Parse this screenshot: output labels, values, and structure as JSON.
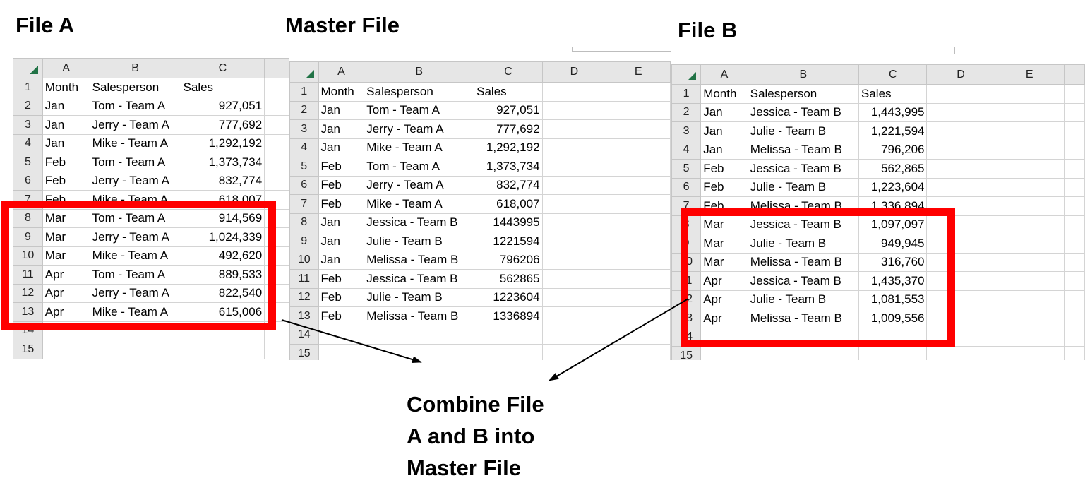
{
  "headings": {
    "file_a": "File A",
    "master": "Master File",
    "file_b": "File B"
  },
  "note": {
    "line1": "Combine File",
    "line2": "A and B into",
    "line3": "Master File"
  },
  "colors": {
    "highlight": "#ff0000",
    "header_bg": "#e6e6e6",
    "select_all": "#217346"
  },
  "icons": {
    "select_all": "select-all-triangle-icon"
  },
  "sheets": {
    "file_a": {
      "columns": [
        "A",
        "B",
        "C"
      ],
      "rows": [
        {
          "n": "1",
          "a": "Month",
          "b": "Salesperson",
          "c": "Sales",
          "d": "",
          "e": ""
        },
        {
          "n": "2",
          "a": "Jan",
          "b": "Tom - Team A",
          "c": "927,051",
          "d": "",
          "e": ""
        },
        {
          "n": "3",
          "a": "Jan",
          "b": "Jerry - Team A",
          "c": "777,692",
          "d": "",
          "e": ""
        },
        {
          "n": "4",
          "a": "Jan",
          "b": "Mike - Team A",
          "c": "1,292,192",
          "d": "",
          "e": ""
        },
        {
          "n": "5",
          "a": "Feb",
          "b": "Tom - Team A",
          "c": "1,373,734",
          "d": "",
          "e": ""
        },
        {
          "n": "6",
          "a": "Feb",
          "b": "Jerry - Team A",
          "c": "832,774",
          "d": "",
          "e": ""
        },
        {
          "n": "7",
          "a": "Feb",
          "b": "Mike - Team A",
          "c": "618,007",
          "d": "",
          "e": ""
        },
        {
          "n": "8",
          "a": "Mar",
          "b": "Tom - Team A",
          "c": "914,569",
          "d": "",
          "e": ""
        },
        {
          "n": "9",
          "a": "Mar",
          "b": "Jerry - Team A",
          "c": "1,024,339",
          "d": "",
          "e": ""
        },
        {
          "n": "10",
          "a": "Mar",
          "b": "Mike - Team A",
          "c": "492,620",
          "d": "",
          "e": ""
        },
        {
          "n": "11",
          "a": "Apr",
          "b": "Tom - Team A",
          "c": "889,533",
          "d": "",
          "e": ""
        },
        {
          "n": "12",
          "a": "Apr",
          "b": "Jerry - Team A",
          "c": "822,540",
          "d": "",
          "e": ""
        },
        {
          "n": "13",
          "a": "Apr",
          "b": "Mike - Team A",
          "c": "615,006",
          "d": "",
          "e": ""
        },
        {
          "n": "14",
          "a": "",
          "b": "",
          "c": "",
          "d": "",
          "e": ""
        },
        {
          "n": "15",
          "a": "",
          "b": "",
          "c": "",
          "d": "",
          "e": ""
        }
      ]
    },
    "master": {
      "columns": [
        "A",
        "B",
        "C",
        "D",
        "E"
      ],
      "rows": [
        {
          "n": "1",
          "a": "Month",
          "b": "Salesperson",
          "c": "Sales",
          "d": "",
          "e": ""
        },
        {
          "n": "2",
          "a": "Jan",
          "b": "Tom - Team A",
          "c": "927,051",
          "d": "",
          "e": ""
        },
        {
          "n": "3",
          "a": "Jan",
          "b": "Jerry - Team A",
          "c": "777,692",
          "d": "",
          "e": ""
        },
        {
          "n": "4",
          "a": "Jan",
          "b": "Mike - Team A",
          "c": "1,292,192",
          "d": "",
          "e": ""
        },
        {
          "n": "5",
          "a": "Feb",
          "b": "Tom - Team A",
          "c": "1,373,734",
          "d": "",
          "e": ""
        },
        {
          "n": "6",
          "a": "Feb",
          "b": "Jerry - Team A",
          "c": "832,774",
          "d": "",
          "e": ""
        },
        {
          "n": "7",
          "a": "Feb",
          "b": "Mike - Team A",
          "c": "618,007",
          "d": "",
          "e": ""
        },
        {
          "n": "8",
          "a": "Jan",
          "b": "Jessica  - Team B",
          "c": "1443995",
          "d": "",
          "e": ""
        },
        {
          "n": "9",
          "a": "Jan",
          "b": "Julie - Team B",
          "c": "1221594",
          "d": "",
          "e": ""
        },
        {
          "n": "10",
          "a": "Jan",
          "b": "Melissa - Team B",
          "c": "796206",
          "d": "",
          "e": ""
        },
        {
          "n": "11",
          "a": "Feb",
          "b": "Jessica  - Team B",
          "c": "562865",
          "d": "",
          "e": ""
        },
        {
          "n": "12",
          "a": "Feb",
          "b": "Julie - Team B",
          "c": "1223604",
          "d": "",
          "e": ""
        },
        {
          "n": "13",
          "a": "Feb",
          "b": "Melissa - Team B",
          "c": "1336894",
          "d": "",
          "e": ""
        },
        {
          "n": "14",
          "a": "",
          "b": "",
          "c": "",
          "d": "",
          "e": ""
        },
        {
          "n": "15",
          "a": "",
          "b": "",
          "c": "",
          "d": "",
          "e": ""
        }
      ]
    },
    "file_b": {
      "columns": [
        "A",
        "B",
        "C",
        "D",
        "E"
      ],
      "rows": [
        {
          "n": "1",
          "a": "Month",
          "b": "Salesperson",
          "c": "Sales",
          "d": "",
          "e": ""
        },
        {
          "n": "2",
          "a": "Jan",
          "b": "Jessica  - Team B",
          "c": "1,443,995",
          "d": "",
          "e": ""
        },
        {
          "n": "3",
          "a": "Jan",
          "b": "Julie - Team B",
          "c": "1,221,594",
          "d": "",
          "e": ""
        },
        {
          "n": "4",
          "a": "Jan",
          "b": "Melissa - Team B",
          "c": "796,206",
          "d": "",
          "e": ""
        },
        {
          "n": "5",
          "a": "Feb",
          "b": "Jessica  - Team B",
          "c": "562,865",
          "d": "",
          "e": ""
        },
        {
          "n": "6",
          "a": "Feb",
          "b": "Julie - Team B",
          "c": "1,223,604",
          "d": "",
          "e": ""
        },
        {
          "n": "7",
          "a": "Feb",
          "b": "Melissa - Team B",
          "c": "1,336,894",
          "d": "",
          "e": ""
        },
        {
          "n": "8",
          "a": "Mar",
          "b": "Jessica  - Team B",
          "c": "1,097,097",
          "d": "",
          "e": ""
        },
        {
          "n": "9",
          "a": "Mar",
          "b": "Julie - Team B",
          "c": "949,945",
          "d": "",
          "e": ""
        },
        {
          "n": "10",
          "a": "Mar",
          "b": "Melissa - Team B",
          "c": "316,760",
          "d": "",
          "e": ""
        },
        {
          "n": "11",
          "a": "Apr",
          "b": "Jessica  - Team B",
          "c": "1,435,370",
          "d": "",
          "e": ""
        },
        {
          "n": "12",
          "a": "Apr",
          "b": "Julie - Team B",
          "c": "1,081,553",
          "d": "",
          "e": ""
        },
        {
          "n": "13",
          "a": "Apr",
          "b": "Melissa - Team B",
          "c": "1,009,556",
          "d": "",
          "e": ""
        },
        {
          "n": "14",
          "a": "",
          "b": "",
          "c": "",
          "d": "",
          "e": ""
        },
        {
          "n": "15",
          "a": "",
          "b": "",
          "c": "",
          "d": "",
          "e": ""
        }
      ]
    }
  }
}
